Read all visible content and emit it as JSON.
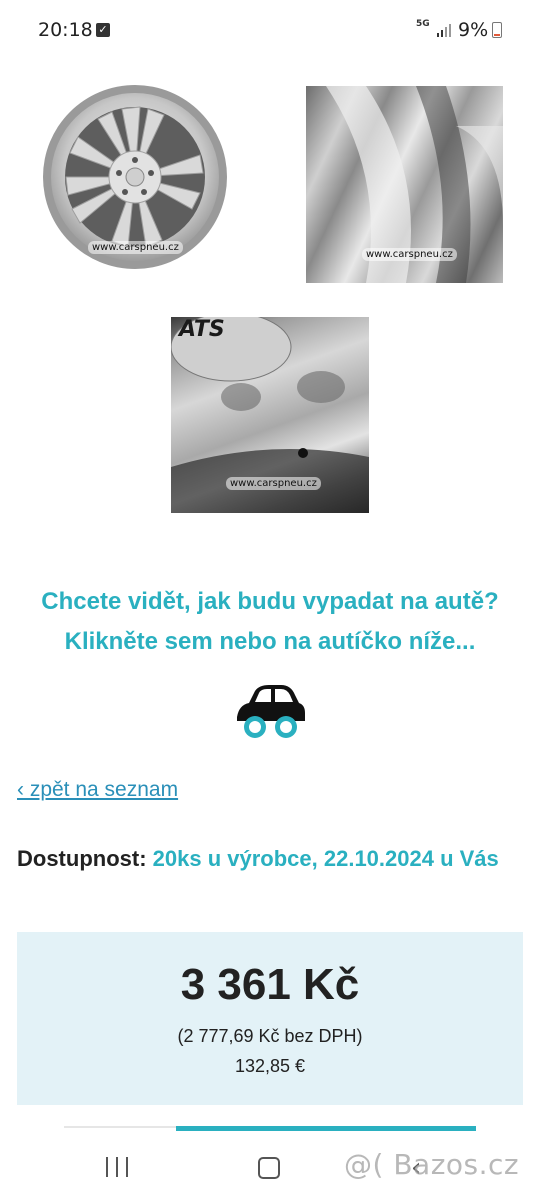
{
  "status_bar": {
    "time": "20:18",
    "network": "5G",
    "battery": "9%",
    "icons": [
      "check-notification-icon",
      "signal-icon",
      "battery-icon"
    ]
  },
  "gallery": {
    "watermark": "www.carspneu.cz",
    "brand": "ATS"
  },
  "cta": {
    "line1": "Chcete vidět, jak budu vypadat na autě?",
    "line2": "Klikněte sem nebo na autíčko níže...",
    "icon": "car-icon"
  },
  "nav": {
    "back_link": "‹ zpět na seznam"
  },
  "availability": {
    "label": "Dostupnost:",
    "value": "20ks u výrobce, 22.10.2024 u Vás"
  },
  "price": {
    "main": "3 361 Kč",
    "net": "(2 777,69 Kč bez DPH)",
    "eur": "132,85 €"
  },
  "system_nav": {
    "icons": [
      "recent-apps-icon",
      "home-icon",
      "back-icon"
    ]
  },
  "site_watermark": "@( Bazos.cz",
  "colors": {
    "accent": "#2ab0c0",
    "link": "#2a8fb8",
    "price_bg": "#e3f2f7"
  }
}
